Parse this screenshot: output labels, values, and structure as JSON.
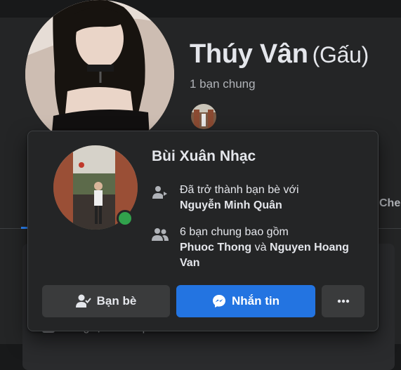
{
  "profile": {
    "name": "Thúy Vân",
    "nickname": "(Gấu)",
    "mutual_friends": "1 bạn chung"
  },
  "background": {
    "partial_tab": "Che",
    "partial_intro": "Sống tại Thành phố Hồ Chí Minh"
  },
  "hover_card": {
    "name": "Bùi Xuân Nhạc",
    "friend_info": {
      "prefix": "Đã trở thành bạn bè với",
      "person": "Nguyễn Minh Quân"
    },
    "mutual_info": {
      "prefix": "6 bạn chung bao gồm",
      "person1": "Phuoc Thong",
      "conjunction": "và",
      "person2": "Nguyen Hoang Van"
    },
    "buttons": {
      "friends_label": "Bạn bè",
      "message_label": "Nhắn tin"
    },
    "colors": {
      "online": "#31a24c",
      "message_button": "#2374e1"
    }
  },
  "icons": {
    "friends_icon": "user-check-icon",
    "message_icon": "messenger-icon",
    "more_icon": "more-dots-icon",
    "friend_since_icon": "user-arrow-icon",
    "mutual_icon": "users-icon"
  }
}
